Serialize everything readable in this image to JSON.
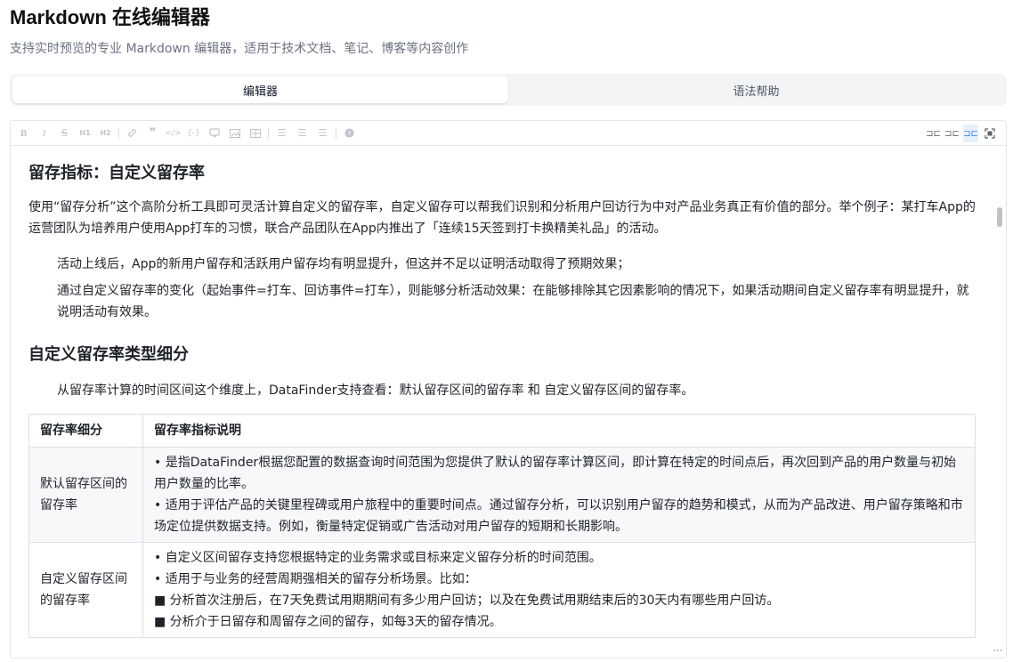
{
  "header": {
    "title": "Markdown 在线编辑器",
    "subtitle": "支持实时预览的专业 Markdown 编辑器，适用于技术文档、笔记、博客等内容创作"
  },
  "tabs": [
    {
      "label": "编辑器",
      "active": true
    },
    {
      "label": "语法帮助",
      "active": false
    }
  ],
  "toolbar": {
    "left_icons": [
      "bold-icon",
      "italic-icon",
      "strikethrough-icon",
      "heading-icon",
      "heading-alt-icon",
      "link-icon",
      "quote-icon",
      "code-icon",
      "code-block-icon",
      "comment-icon",
      "image-icon",
      "table-icon",
      "unordered-list-icon",
      "ordered-list-icon",
      "task-list-icon",
      "help-icon"
    ],
    "right_icons": [
      "edit-mode-icon",
      "split-mode-icon",
      "preview-mode-icon",
      "fullscreen-icon"
    ],
    "active_mode": "preview-mode"
  },
  "content": {
    "h1": "留存指标：自定义留存率",
    "p1": "使用“留存分析”这个高阶分析工具即可灵活计算自定义的留存率，自定义留存可以帮我们识别和分析用户回访行为中对产品业务真正有价值的部分。举个例子：某打车App的运营团队为培养用户使用App打车的习惯，联合产品团队在App内推出了「连续15天签到打卡换精美礼品」的活动。",
    "p2": "活动上线后，App的新用户留存和活跃用户留存均有明显提升，但这并不足以证明活动取得了预期效果；",
    "p3": "通过自定义留存率的变化（起始事件=打车、回访事件=打车），则能够分析活动效果：在能够排除其它因素影响的情况下，如果活动期间自定义留存率有明显提升，就说明活动有效果。",
    "h2": "自定义留存率类型细分",
    "p4": "从留存率计算的时间区间这个维度上，DataFinder支持查看：默认留存区间的留存率 和 自定义留存区间的留存率。",
    "table": {
      "headers": [
        "留存率细分",
        "留存率指标说明"
      ],
      "rows": [
        {
          "name": "默认留存区间的留存率",
          "lines": [
            "• 是指DataFinder根据您配置的数据查询时间范围为您提供了默认的留存率计算区间，即计算在特定的时间点后，再次回到产品的用户数量与初始用户数量的比率。",
            "• 适用于评估产品的关键里程碑或用户旅程中的重要时间点。通过留存分析，可以识别用户留存的趋势和模式，从而为产品改进、用户留存策略和市场定位提供数据支持。例如，衡量特定促销或广告活动对用户留存的短期和长期影响。"
          ]
        },
        {
          "name": "自定义留存区间的留存率",
          "lines": [
            "• 自定义区间留存支持您根据特定的业务需求或目标来定义留存分析的时间范围。",
            "• 适用于与业务的经营周期强相关的留存分析场景。比如：",
            "■ 分析首次注册后，在7天免费试用期期间有多少用户回访；以及在免费试用期结束后的30天内有哪些用户回访。",
            "■ 分析介于日留存和周留存之间的留存，如每3天的留存情况。"
          ]
        }
      ]
    }
  }
}
